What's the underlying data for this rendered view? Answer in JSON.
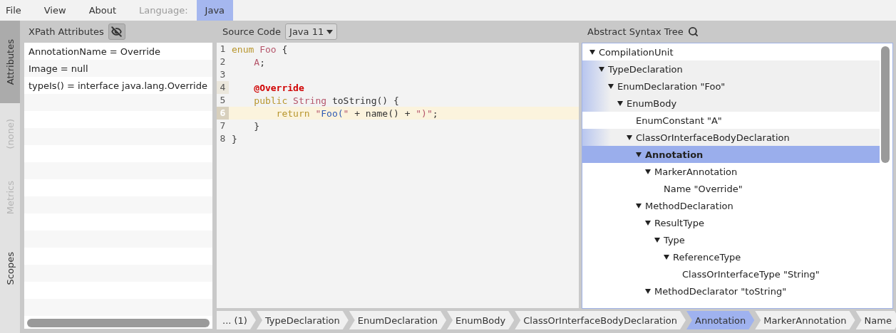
{
  "menu": [
    {
      "label": "File",
      "kind": "menu",
      "selected": false
    },
    {
      "label": "View",
      "kind": "menu",
      "selected": false
    },
    {
      "label": "About",
      "kind": "menu",
      "selected": false
    },
    {
      "label": "Language:",
      "kind": "caption",
      "selected": false
    },
    {
      "label": "Java",
      "kind": "menu",
      "selected": true
    }
  ],
  "side_tabs": [
    {
      "label": "Attributes",
      "selected": true,
      "disabled": false
    },
    {
      "label": "(none)",
      "selected": false,
      "disabled": true
    },
    {
      "label": "Metrics",
      "selected": false,
      "disabled": true
    },
    {
      "label": "Scopes",
      "selected": false,
      "disabled": false
    }
  ],
  "attributes": {
    "title": "XPath Attributes",
    "rows": [
      "AnnotationName = Override",
      "Image = null",
      "typeIs() = interface java.lang.Override"
    ]
  },
  "source": {
    "title": "Source Code",
    "language": "Java 11",
    "lines": [
      {
        "number": "1",
        "marked": false,
        "current": false,
        "tokens": [
          {
            "kind": "keyword",
            "text": "enum"
          },
          {
            "kind": "type",
            "text": " Foo"
          },
          {
            "kind": "plain",
            "text": " {"
          }
        ]
      },
      {
        "number": "2",
        "marked": false,
        "current": false,
        "tokens": [
          {
            "kind": "type",
            "text": "    A"
          },
          {
            "kind": "plain",
            "text": ";"
          }
        ]
      },
      {
        "number": "3",
        "marked": false,
        "current": false
      },
      {
        "number": "4",
        "marked": true,
        "current": false,
        "tokens": [
          {
            "kind": "annotation",
            "text": "    @Override"
          }
        ]
      },
      {
        "number": "5",
        "marked": false,
        "current": false,
        "tokens": [
          {
            "kind": "keyword",
            "text": "    public"
          },
          {
            "kind": "type",
            "text": " String"
          },
          {
            "kind": "plain",
            "text": " toString() {"
          }
        ]
      },
      {
        "number": "6",
        "marked": false,
        "current": true,
        "tokens": [
          {
            "kind": "keyword",
            "text": "        return"
          },
          {
            "kind": "quote",
            "text": " \""
          },
          {
            "kind": "string",
            "text": "Foo("
          },
          {
            "kind": "quote",
            "text": "\""
          },
          {
            "kind": "plain",
            "text": " + name() + "
          },
          {
            "kind": "quote",
            "text": "\")\""
          },
          {
            "kind": "plain",
            "text": ";"
          }
        ]
      },
      {
        "number": "7",
        "marked": false,
        "current": false,
        "tokens": [
          {
            "kind": "plain",
            "text": "    }"
          }
        ]
      },
      {
        "number": "8",
        "marked": false,
        "current": false,
        "tokens": [
          {
            "kind": "plain",
            "text": "}"
          }
        ]
      }
    ],
    "breadcrumbs": [
      {
        "label": "... (1)",
        "selected": false
      },
      {
        "label": "TypeDeclaration",
        "selected": false
      },
      {
        "label": "EnumDeclaration",
        "selected": false
      },
      {
        "label": "EnumBody",
        "selected": false
      },
      {
        "label": "ClassOrInterfaceBodyDeclaration",
        "selected": false
      },
      {
        "label": "Annotation",
        "selected": true
      },
      {
        "label": "MarkerAnnotation",
        "selected": false
      },
      {
        "label": "Name",
        "selected": false
      }
    ]
  },
  "ast": {
    "title": "Abstract Syntax Tree",
    "nodes": [
      {
        "label": "CompilationUnit",
        "expanded": true,
        "selected": false,
        "ancestor": false,
        "children": [
          {
            "label": "TypeDeclaration",
            "expanded": true,
            "selected": false,
            "ancestor": true,
            "children": [
              {
                "label": "EnumDeclaration \"Foo\"",
                "expanded": true,
                "selected": false,
                "ancestor": true,
                "children": [
                  {
                    "label": "EnumBody",
                    "expanded": true,
                    "selected": false,
                    "ancestor": true,
                    "children": [
                      {
                        "label": "EnumConstant \"A\"",
                        "expanded": false,
                        "selected": false,
                        "ancestor": false
                      },
                      {
                        "label": "ClassOrInterfaceBodyDeclaration",
                        "expanded": true,
                        "selected": false,
                        "ancestor": true,
                        "children": [
                          {
                            "label": "Annotation",
                            "expanded": true,
                            "selected": true,
                            "ancestor": false,
                            "children": [
                              {
                                "label": "MarkerAnnotation",
                                "expanded": true,
                                "selected": false,
                                "ancestor": false,
                                "children": [
                                  {
                                    "label": "Name \"Override\"",
                                    "expanded": false,
                                    "selected": false,
                                    "ancestor": false
                                  }
                                ]
                              }
                            ]
                          },
                          {
                            "label": "MethodDeclaration",
                            "expanded": true,
                            "selected": false,
                            "ancestor": false,
                            "children": [
                              {
                                "label": "ResultType",
                                "expanded": true,
                                "selected": false,
                                "ancestor": false,
                                "children": [
                                  {
                                    "label": "Type",
                                    "expanded": true,
                                    "selected": false,
                                    "ancestor": false,
                                    "children": [
                                      {
                                        "label": "ReferenceType",
                                        "expanded": true,
                                        "selected": false,
                                        "ancestor": false,
                                        "children": [
                                          {
                                            "label": "ClassOrInterfaceType \"String\"",
                                            "expanded": false,
                                            "selected": false,
                                            "ancestor": false
                                          }
                                        ]
                                      }
                                    ]
                                  }
                                ]
                              },
                              {
                                "label": "MethodDeclarator \"toString\"",
                                "expanded": true,
                                "selected": false,
                                "ancestor": false
                              }
                            ]
                          }
                        ]
                      }
                    ]
                  }
                ]
              }
            ]
          }
        ]
      }
    ]
  }
}
